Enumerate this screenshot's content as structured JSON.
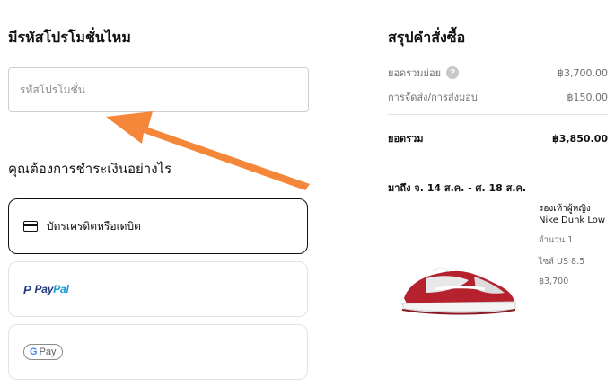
{
  "promo": {
    "heading": "มีรหัสโปรโมชั่นไหม",
    "placeholder": "รหัสโปรโมชั่น",
    "value": ""
  },
  "payment": {
    "heading": "คุณต้องการชำระเงินอย่างไร",
    "options": [
      {
        "id": "card",
        "label": "บัตรเครดิตหรือเดบิต",
        "selected": true,
        "icon": "credit-card-icon"
      },
      {
        "id": "paypal",
        "mark": "P",
        "pay": "Pay",
        "pal": "Pal",
        "selected": false,
        "icon": "paypal-logo"
      },
      {
        "id": "gpay",
        "g": "G",
        "pay": "Pay",
        "selected": false,
        "icon": "google-pay-logo"
      }
    ]
  },
  "summary": {
    "title": "สรุปคำสั่งซื้อ",
    "subtotal_label": "ยอดรวมย่อย",
    "subtotal_value": "฿3,700.00",
    "help_icon": "?",
    "delivery_label": "การจัดส่ง/การส่งมอบ",
    "delivery_value": "฿150.00",
    "total_label": "ยอดรวม",
    "total_value": "฿3,850.00"
  },
  "delivery": {
    "arrival_text": "มาถึง จ. 14 ส.ค. - ศ. 18 ส.ค."
  },
  "product": {
    "name": "รองเท้าผู้หญิง Nike Dunk Low",
    "quantity": "จำนวน 1",
    "size": "ไซส์ US 8.5",
    "price": "฿3,700"
  },
  "colors": {
    "accent_arrow": "#f5873a",
    "selected_border": "#111111",
    "paypal_dark": "#253b80",
    "paypal_light": "#179bd7",
    "shoe_red": "#b5222d"
  }
}
